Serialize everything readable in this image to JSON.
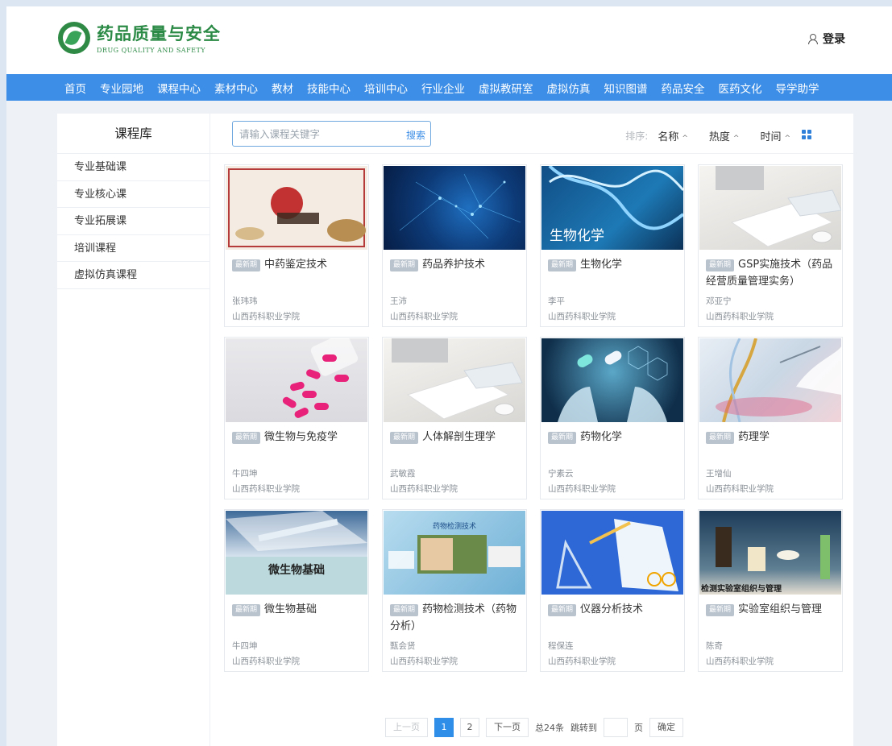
{
  "brand": {
    "name_cn": "药品质量与安全",
    "name_en": "DRUG QUALITY AND SAFETY"
  },
  "header": {
    "login_label": "登录"
  },
  "nav": {
    "items": [
      "首页",
      "专业园地",
      "课程中心",
      "素材中心",
      "教材",
      "技能中心",
      "培训中心",
      "行业企业",
      "虚拟教研室",
      "虚拟仿真",
      "知识图谱",
      "药品安全",
      "医药文化",
      "导学助学"
    ]
  },
  "sidebar": {
    "title": "课程库",
    "items": [
      "专业基础课",
      "专业核心课",
      "专业拓展课",
      "培训课程",
      "虚拟仿真课程"
    ]
  },
  "toolbar": {
    "search_placeholder": "请输入课程关键字",
    "search_button": "搜索",
    "sort_label": "排序:",
    "sort_options": [
      "名称",
      "热度",
      "时间"
    ],
    "sort_caret": "^"
  },
  "courses": [
    {
      "badge": "最新期",
      "title": "中药鉴定技术",
      "teacher": "张玮玮",
      "school": "山西药科职业学院",
      "thumb_text": ""
    },
    {
      "badge": "最新期",
      "title": "药品养护技术",
      "teacher": "王沛",
      "school": "山西药科职业学院",
      "thumb_text": ""
    },
    {
      "badge": "最新期",
      "title": "生物化学",
      "teacher": "李平",
      "school": "山西药科职业学院",
      "thumb_text": "生物化学"
    },
    {
      "badge": "最新期",
      "title": "GSP实施技术（药品经营质量管理实务）",
      "teacher": "邓亚宁",
      "school": "山西药科职业学院",
      "thumb_text": ""
    },
    {
      "badge": "最新期",
      "title": "微生物与免疫学",
      "teacher": "牛四坤",
      "school": "山西药科职业学院",
      "thumb_text": ""
    },
    {
      "badge": "最新期",
      "title": "人体解剖生理学",
      "teacher": "武敏霞",
      "school": "山西药科职业学院",
      "thumb_text": ""
    },
    {
      "badge": "最新期",
      "title": "药物化学",
      "teacher": "宁素云",
      "school": "山西药科职业学院",
      "thumb_text": ""
    },
    {
      "badge": "最新期",
      "title": "药理学",
      "teacher": "王增仙",
      "school": "山西药科职业学院",
      "thumb_text": ""
    },
    {
      "badge": "最新期",
      "title": "微生物基础",
      "teacher": "牛四坤",
      "school": "山西药科职业学院",
      "thumb_text": "微生物基础"
    },
    {
      "badge": "最新期",
      "title": "药物检测技术（药物分析）",
      "teacher": "甄会贤",
      "school": "山西药科职业学院",
      "thumb_text": "药物检测技术"
    },
    {
      "badge": "最新期",
      "title": "仪器分析技术",
      "teacher": "程保连",
      "school": "山西药科职业学院",
      "thumb_text": ""
    },
    {
      "badge": "最新期",
      "title": "实验室组织与管理",
      "teacher": "陈奇",
      "school": "山西药科职业学院",
      "thumb_text": "检测实验室组织与管理"
    }
  ],
  "pager": {
    "prev": "上一页",
    "pages": [
      "1",
      "2"
    ],
    "active_page": "1",
    "next": "下一页",
    "total": "总24条",
    "jump_label": "跳转到",
    "page_unit": "页",
    "confirm": "确定"
  }
}
